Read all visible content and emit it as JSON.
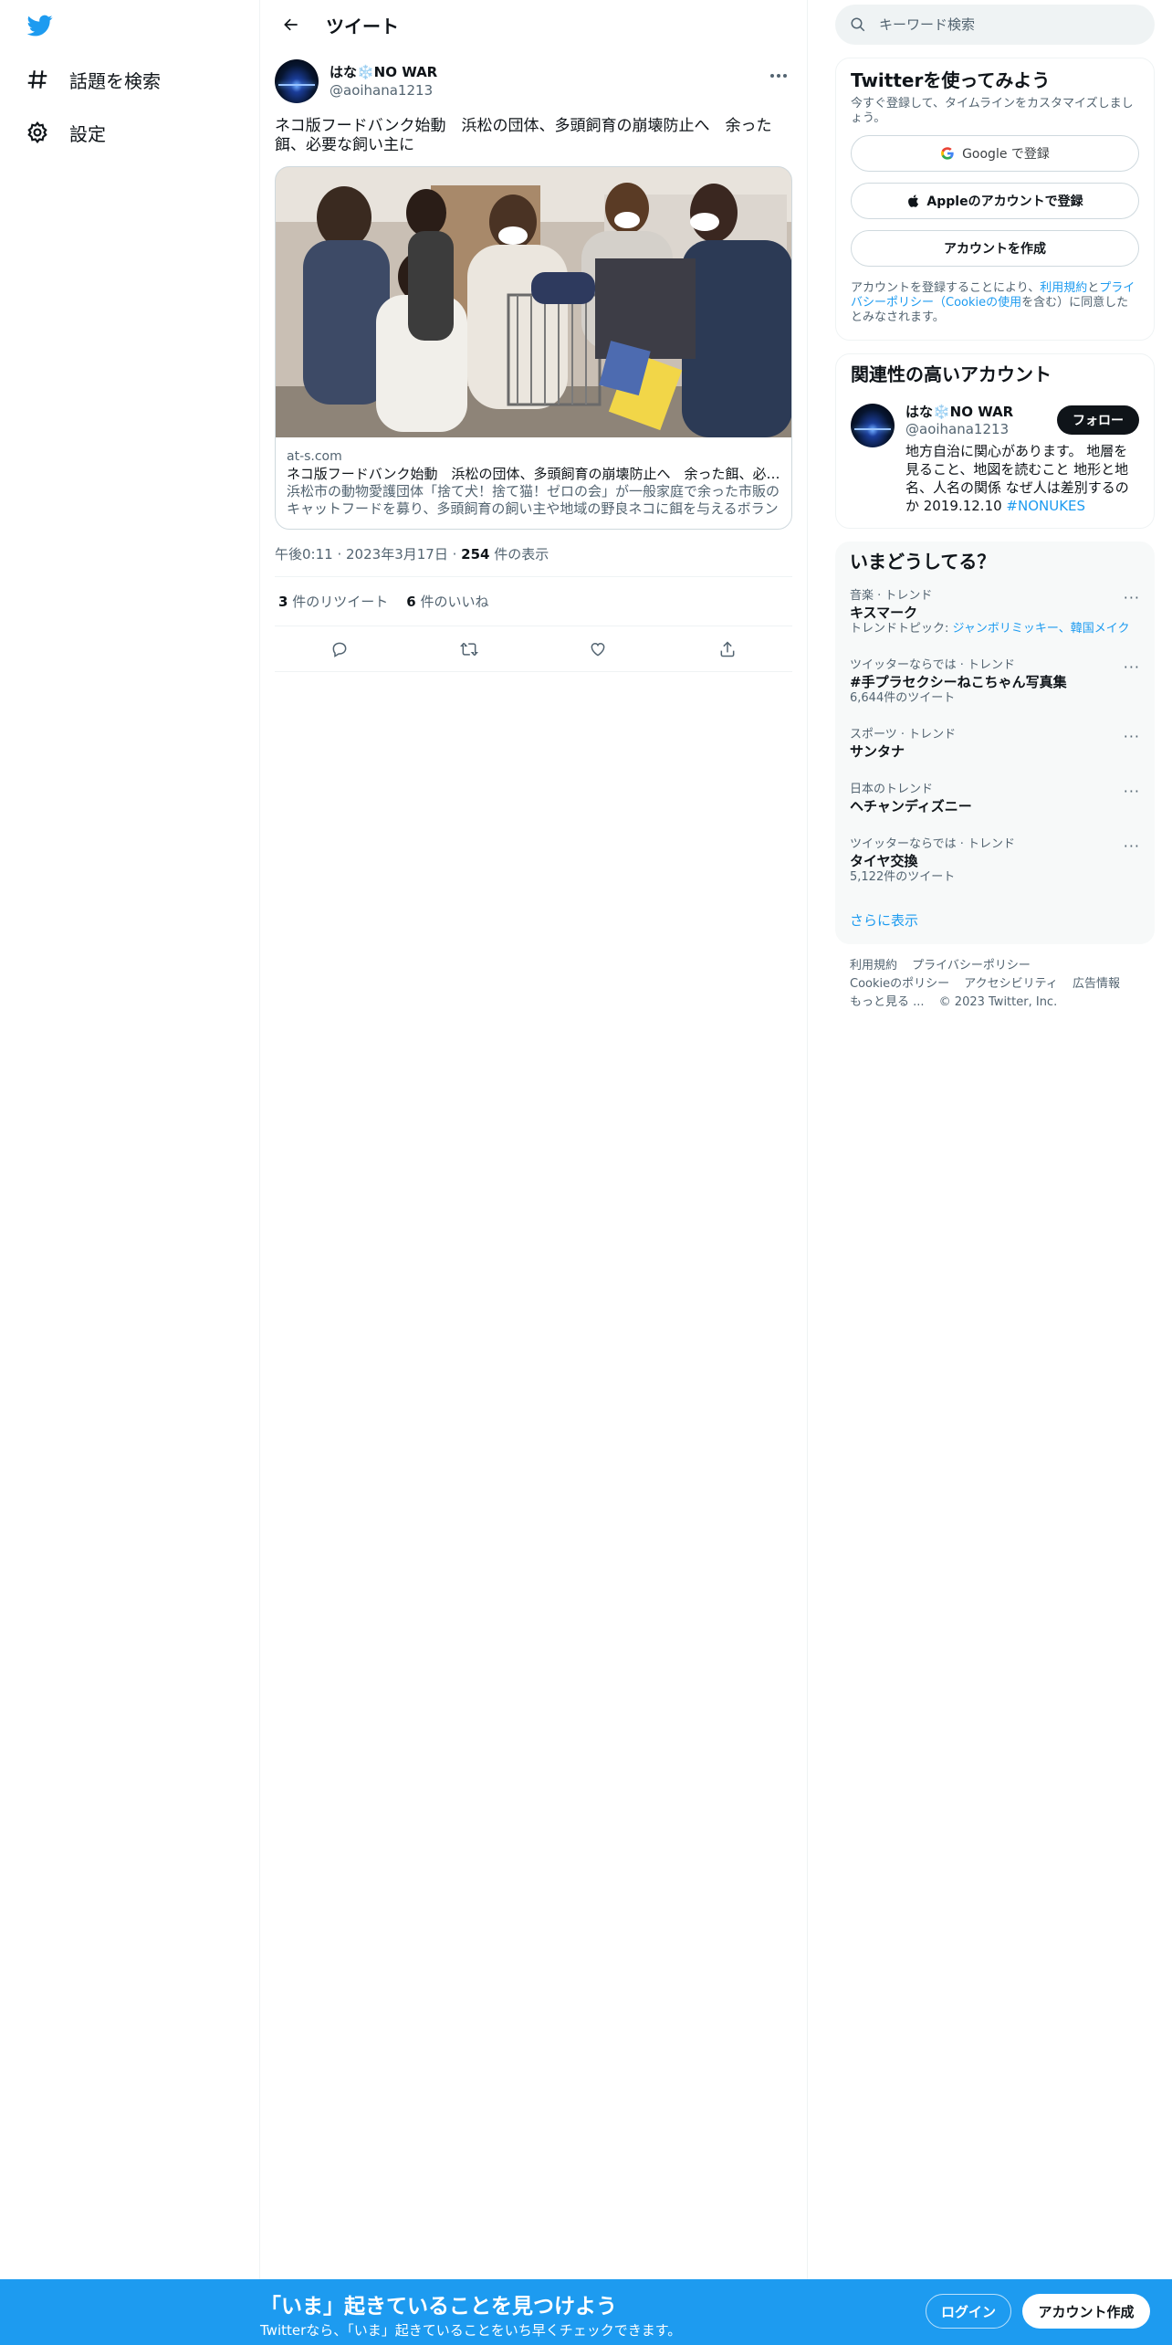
{
  "nav": {
    "items": [
      {
        "label": "話題を検索",
        "icon": "hashtag-icon"
      },
      {
        "label": "設定",
        "icon": "gear-icon"
      }
    ]
  },
  "header": {
    "title": "ツイート"
  },
  "tweet": {
    "author_name": "はな❄️NO WAR",
    "author_handle": "@aoihana1213",
    "text": "ネコ版フードバンク始動　浜松の団体、多頭飼育の崩壊防止へ　余った餌、必要な飼い主に",
    "card": {
      "domain": "at-s.com",
      "title": "ネコ版フードバンク始動　浜松の団体、多頭飼育の崩壊防止へ　余った餌、必要な飼い主に",
      "description": "浜松市の動物愛護団体「捨て犬！捨て猫！ゼロの会」が一般家庭で余った市販のキャットフードを募り、多頭飼育の飼い主や地域の野良ネコに餌を与えるボランティアに届ける取り組みを始めた。"
    },
    "time": "午後0:11",
    "date": "2023年3月17日",
    "views": "254",
    "views_label": "件の表示",
    "retweets": "3",
    "retweets_label": "件のリツイート",
    "likes": "6",
    "likes_label": "件のいいね"
  },
  "search": {
    "placeholder": "キーワード検索"
  },
  "signup": {
    "title": "Twitterを使ってみよう",
    "desc": "今すぐ登録して、タイムラインをカスタマイズしましょう。",
    "google": "Google で登録",
    "apple": "Appleのアカウントで登録",
    "create": "アカウントを作成",
    "terms_1": "アカウントを登録することにより、",
    "terms_link_1": "利用規約",
    "terms_2": "と",
    "terms_link_2": "プライバシーポリシー（Cookieの使用",
    "terms_3": "を含む）に同意したとみなされます。"
  },
  "related": {
    "title": "関連性の高いアカウント",
    "name": "はな❄️NO WAR",
    "handle": "@aoihana1213",
    "bio": "地方自治に関心があります。 地層を見ること、地図を読むこと 地形と地名、人名の関係 なぜ人は差別するのか 2019.12.10 ",
    "bio_tag": "#NONUKES",
    "follow": "フォロー"
  },
  "trends": {
    "title": "いまどうしてる？",
    "items": [
      {
        "category": "音楽 · トレンド",
        "name": "キスマーク",
        "sub_prefix": "トレンドトピック: ",
        "sub_link": "ジャンボリミッキー、韓国メイク"
      },
      {
        "category": "ツイッターならでは · トレンド",
        "name": "#手プラセクシーねこちゃん写真集",
        "sub": "6,644件のツイート"
      },
      {
        "category": "スポーツ · トレンド",
        "name": "サンタナ",
        "sub": ""
      },
      {
        "category": "日本のトレンド",
        "name": "ヘチャンディズニー",
        "sub": ""
      },
      {
        "category": "ツイッターならでは · トレンド",
        "name": "タイヤ交換",
        "sub": "5,122件のツイート"
      }
    ],
    "show_more": "さらに表示"
  },
  "footer": {
    "links": [
      "利用規約",
      "プライバシーポリシー",
      "Cookieのポリシー",
      "アクセシビリティ",
      "広告情報",
      "もっと見る ..."
    ],
    "copyright": "© 2023 Twitter, Inc."
  },
  "bottom": {
    "title": "「いま」起きていることを見つけよう",
    "sub": "Twitterなら、「いま」起きていることをいち早くチェックできます。",
    "login": "ログイン",
    "signup": "アカウント作成"
  },
  "colors": {
    "accent": "#1d9bf0",
    "text": "#0f1419",
    "secondary": "#536471"
  }
}
